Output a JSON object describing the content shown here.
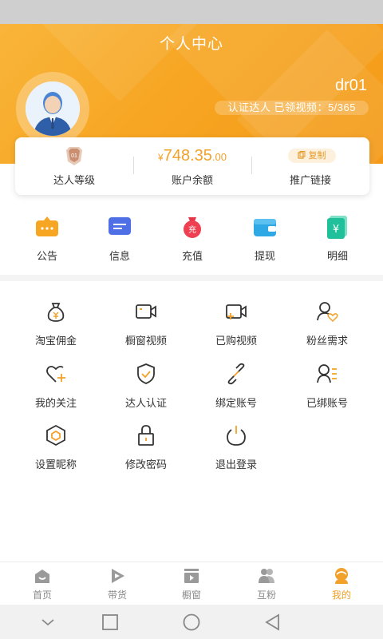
{
  "header": {
    "title": "个人中心",
    "username": "dr01",
    "certification": "认证达人 已领视频：5/365",
    "avatar_icon": "user-avatar-icon",
    "color_start": "#f9b53a",
    "color_end": "#f49a18"
  },
  "stats": {
    "level": {
      "badge": "01",
      "label": "达人等级"
    },
    "balance": {
      "currency": "¥",
      "integer": "748.35",
      "decimal": ".00",
      "label": "账户余额"
    },
    "promo": {
      "copy_label": "复制",
      "label": "推广链接"
    }
  },
  "quick_actions": [
    {
      "label": "公告",
      "icon": "announcement-icon"
    },
    {
      "label": "信息",
      "icon": "message-icon"
    },
    {
      "label": "充值",
      "icon": "recharge-bag-icon"
    },
    {
      "label": "提现",
      "icon": "wallet-icon"
    },
    {
      "label": "明细",
      "icon": "detail-yen-icon"
    }
  ],
  "menu": [
    {
      "label": "淘宝佣金",
      "icon": "money-bag-icon"
    },
    {
      "label": "橱窗视频",
      "icon": "video-camera-icon"
    },
    {
      "label": "已购视频",
      "icon": "purchased-video-icon"
    },
    {
      "label": "粉丝需求",
      "icon": "fan-heart-icon"
    },
    {
      "label": "我的关注",
      "icon": "heart-plus-icon"
    },
    {
      "label": "达人认证",
      "icon": "shield-check-icon"
    },
    {
      "label": "绑定账号",
      "icon": "link-icon"
    },
    {
      "label": "已绑账号",
      "icon": "user-list-icon"
    },
    {
      "label": "设置昵称",
      "icon": "hexagon-icon"
    },
    {
      "label": "修改密码",
      "icon": "lock-icon"
    },
    {
      "label": "退出登录",
      "icon": "power-icon"
    }
  ],
  "tabbar": [
    {
      "label": "首页",
      "icon": "home-icon",
      "active": false
    },
    {
      "label": "带货",
      "icon": "play-icon",
      "active": false
    },
    {
      "label": "橱窗",
      "icon": "showcase-icon",
      "active": false
    },
    {
      "label": "互粉",
      "icon": "users-icon",
      "active": false
    },
    {
      "label": "我的",
      "icon": "profile-icon",
      "active": true
    }
  ],
  "accent_color": "#f2a12a"
}
